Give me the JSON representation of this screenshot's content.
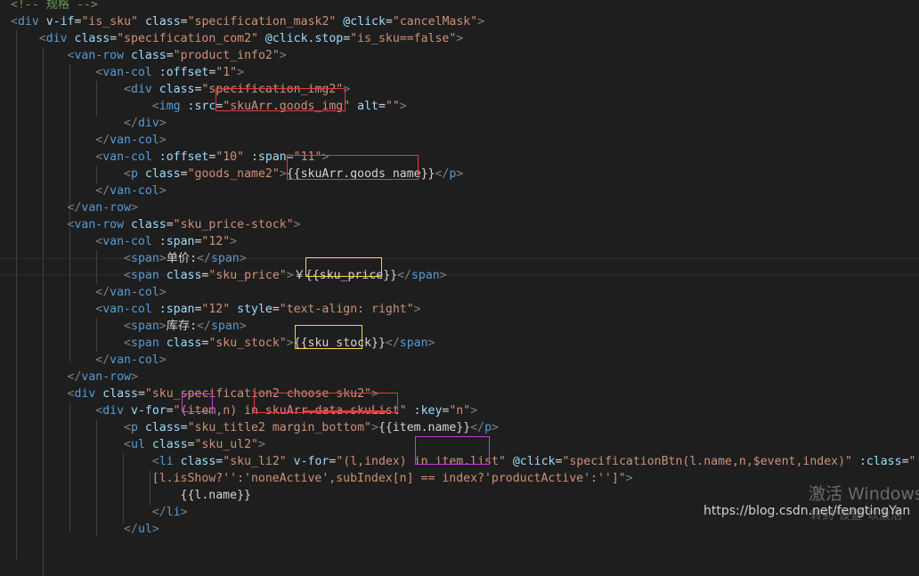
{
  "editor": {
    "lines": [
      [
        [
          "c",
          "<!-- 规格 -->"
        ]
      ],
      [
        [
          "p",
          "<"
        ],
        [
          "t",
          "div"
        ],
        [
          "x",
          " "
        ],
        [
          "a",
          "v-if"
        ],
        [
          "x",
          "="
        ],
        [
          "s",
          "\"is_sku\""
        ],
        [
          "x",
          " "
        ],
        [
          "a",
          "class"
        ],
        [
          "x",
          "="
        ],
        [
          "s",
          "\"specification_mask2\""
        ],
        [
          "x",
          " "
        ],
        [
          "a",
          "@click"
        ],
        [
          "x",
          "="
        ],
        [
          "s",
          "\"cancelMask\""
        ],
        [
          "p",
          ">"
        ]
      ],
      [
        [
          "x",
          "    "
        ],
        [
          "p",
          "<"
        ],
        [
          "t",
          "div"
        ],
        [
          "x",
          " "
        ],
        [
          "a",
          "class"
        ],
        [
          "x",
          "="
        ],
        [
          "s",
          "\"specification_com2\""
        ],
        [
          "x",
          " "
        ],
        [
          "a",
          "@click.stop"
        ],
        [
          "x",
          "="
        ],
        [
          "s",
          "\"is_sku==false\""
        ],
        [
          "p",
          ">"
        ]
      ],
      [
        [
          "x",
          "        "
        ],
        [
          "p",
          "<"
        ],
        [
          "t",
          "van-row"
        ],
        [
          "x",
          " "
        ],
        [
          "a",
          "class"
        ],
        [
          "x",
          "="
        ],
        [
          "s",
          "\"product_info2\""
        ],
        [
          "p",
          ">"
        ]
      ],
      [
        [
          "x",
          "            "
        ],
        [
          "p",
          "<"
        ],
        [
          "t",
          "van-col"
        ],
        [
          "x",
          " "
        ],
        [
          "a",
          ":offset"
        ],
        [
          "x",
          "="
        ],
        [
          "s",
          "\"1\""
        ],
        [
          "p",
          ">"
        ]
      ],
      [
        [
          "x",
          "                "
        ],
        [
          "p",
          "<"
        ],
        [
          "t",
          "div"
        ],
        [
          "x",
          " "
        ],
        [
          "a",
          "class"
        ],
        [
          "x",
          "="
        ],
        [
          "s",
          "\"specification_img2\""
        ],
        [
          "p",
          ">"
        ]
      ],
      [
        [
          "x",
          "                    "
        ],
        [
          "p",
          "<"
        ],
        [
          "t",
          "img"
        ],
        [
          "x",
          " "
        ],
        [
          "a",
          ":src"
        ],
        [
          "x",
          "="
        ],
        [
          "s",
          "\"skuArr.goods_img\""
        ],
        [
          "x",
          " "
        ],
        [
          "a",
          "alt"
        ],
        [
          "x",
          "="
        ],
        [
          "s",
          "\"\""
        ],
        [
          "p",
          ">"
        ]
      ],
      [
        [
          "x",
          "                "
        ],
        [
          "p",
          "</"
        ],
        [
          "t",
          "div"
        ],
        [
          "p",
          ">"
        ]
      ],
      [
        [
          "x",
          "            "
        ],
        [
          "p",
          "</"
        ],
        [
          "t",
          "van-col"
        ],
        [
          "p",
          ">"
        ]
      ],
      [
        [
          "x",
          "            "
        ],
        [
          "p",
          "<"
        ],
        [
          "t",
          "van-col"
        ],
        [
          "x",
          " "
        ],
        [
          "a",
          ":offset"
        ],
        [
          "x",
          "="
        ],
        [
          "s",
          "\"10\""
        ],
        [
          "x",
          " "
        ],
        [
          "a",
          ":span"
        ],
        [
          "x",
          "="
        ],
        [
          "s",
          "\"11\""
        ],
        [
          "p",
          ">"
        ]
      ],
      [
        [
          "x",
          "                "
        ],
        [
          "p",
          "<"
        ],
        [
          "t",
          "p"
        ],
        [
          "x",
          " "
        ],
        [
          "a",
          "class"
        ],
        [
          "x",
          "="
        ],
        [
          "s",
          "\"goods_name2\""
        ],
        [
          "p",
          ">"
        ],
        [
          "x",
          "{{skuArr.goods_name}}"
        ],
        [
          "p",
          "</"
        ],
        [
          "t",
          "p"
        ],
        [
          "p",
          ">"
        ]
      ],
      [
        [
          "x",
          "            "
        ],
        [
          "p",
          "</"
        ],
        [
          "t",
          "van-col"
        ],
        [
          "p",
          ">"
        ]
      ],
      [
        [
          "x",
          "        "
        ],
        [
          "p",
          "</"
        ],
        [
          "t",
          "van-row"
        ],
        [
          "p",
          ">"
        ]
      ],
      [
        [
          "x",
          "        "
        ],
        [
          "p",
          "<"
        ],
        [
          "t",
          "van-row"
        ],
        [
          "x",
          " "
        ],
        [
          "a",
          "class"
        ],
        [
          "x",
          "="
        ],
        [
          "s",
          "\"sku_price-stock\""
        ],
        [
          "p",
          ">"
        ]
      ],
      [
        [
          "x",
          "            "
        ],
        [
          "p",
          "<"
        ],
        [
          "t",
          "van-col"
        ],
        [
          "x",
          " "
        ],
        [
          "a",
          ":span"
        ],
        [
          "x",
          "="
        ],
        [
          "s",
          "\"12\""
        ],
        [
          "p",
          ">"
        ]
      ],
      [
        [
          "x",
          "                "
        ],
        [
          "p",
          "<"
        ],
        [
          "t",
          "span"
        ],
        [
          "p",
          ">"
        ],
        [
          "x",
          "单价:"
        ],
        [
          "p",
          "</"
        ],
        [
          "t",
          "span"
        ],
        [
          "p",
          ">"
        ]
      ],
      [
        [
          "x",
          "                "
        ],
        [
          "p",
          "<"
        ],
        [
          "t",
          "span"
        ],
        [
          "x",
          " "
        ],
        [
          "a",
          "class"
        ],
        [
          "x",
          "="
        ],
        [
          "s",
          "\"sku_price\""
        ],
        [
          "p",
          ">"
        ],
        [
          "x",
          "￥{{sku_price}}"
        ],
        [
          "p",
          "</"
        ],
        [
          "t",
          "span"
        ],
        [
          "p",
          ">"
        ]
      ],
      [
        [
          "x",
          "            "
        ],
        [
          "p",
          "</"
        ],
        [
          "t",
          "van-col"
        ],
        [
          "p",
          ">"
        ]
      ],
      [
        [
          "x",
          "            "
        ],
        [
          "p",
          "<"
        ],
        [
          "t",
          "van-col"
        ],
        [
          "x",
          " "
        ],
        [
          "a",
          ":span"
        ],
        [
          "x",
          "="
        ],
        [
          "s",
          "\"12\""
        ],
        [
          "x",
          " "
        ],
        [
          "a",
          "style"
        ],
        [
          "x",
          "="
        ],
        [
          "s",
          "\"text-align: right\""
        ],
        [
          "p",
          ">"
        ]
      ],
      [
        [
          "x",
          "                "
        ],
        [
          "p",
          "<"
        ],
        [
          "t",
          "span"
        ],
        [
          "p",
          ">"
        ],
        [
          "x",
          "库存:"
        ],
        [
          "p",
          "</"
        ],
        [
          "t",
          "span"
        ],
        [
          "p",
          ">"
        ]
      ],
      [
        [
          "x",
          "                "
        ],
        [
          "p",
          "<"
        ],
        [
          "t",
          "span"
        ],
        [
          "x",
          " "
        ],
        [
          "a",
          "class"
        ],
        [
          "x",
          "="
        ],
        [
          "s",
          "\"sku_stock\""
        ],
        [
          "p",
          ">"
        ],
        [
          "x",
          "{{sku_stock}}"
        ],
        [
          "p",
          "</"
        ],
        [
          "t",
          "span"
        ],
        [
          "p",
          ">"
        ]
      ],
      [
        [
          "x",
          "            "
        ],
        [
          "p",
          "</"
        ],
        [
          "t",
          "van-col"
        ],
        [
          "p",
          ">"
        ]
      ],
      [
        [
          "x",
          "        "
        ],
        [
          "p",
          "</"
        ],
        [
          "t",
          "van-row"
        ],
        [
          "p",
          ">"
        ]
      ],
      [
        [
          "x",
          "        "
        ],
        [
          "p",
          "<"
        ],
        [
          "t",
          "div"
        ],
        [
          "x",
          " "
        ],
        [
          "a",
          "class"
        ],
        [
          "x",
          "="
        ],
        [
          "s",
          "\"sku_specification2 choose sku2\""
        ],
        [
          "p",
          ">"
        ]
      ],
      [
        [
          "x",
          "            "
        ],
        [
          "p",
          "<"
        ],
        [
          "t",
          "div"
        ],
        [
          "x",
          " "
        ],
        [
          "a",
          "v-for"
        ],
        [
          "x",
          "="
        ],
        [
          "s",
          "\"(item,n) in skuArr.data.skuList\""
        ],
        [
          "x",
          " "
        ],
        [
          "a",
          ":key"
        ],
        [
          "x",
          "="
        ],
        [
          "s",
          "\"n\""
        ],
        [
          "p",
          ">"
        ]
      ],
      [
        [
          "x",
          "                "
        ],
        [
          "p",
          "<"
        ],
        [
          "t",
          "p"
        ],
        [
          "x",
          " "
        ],
        [
          "a",
          "class"
        ],
        [
          "x",
          "="
        ],
        [
          "s",
          "\"sku_title2 margin_bottom\""
        ],
        [
          "p",
          ">"
        ],
        [
          "x",
          "{{item.name}}"
        ],
        [
          "p",
          "</"
        ],
        [
          "t",
          "p"
        ],
        [
          "p",
          ">"
        ]
      ],
      [
        [
          "x",
          "                "
        ],
        [
          "p",
          "<"
        ],
        [
          "t",
          "ul"
        ],
        [
          "x",
          " "
        ],
        [
          "a",
          "class"
        ],
        [
          "x",
          "="
        ],
        [
          "s",
          "\"sku_ul2\""
        ],
        [
          "p",
          ">"
        ]
      ],
      [
        [
          "x",
          "                    "
        ],
        [
          "p",
          "<"
        ],
        [
          "t",
          "li"
        ],
        [
          "x",
          " "
        ],
        [
          "a",
          "class"
        ],
        [
          "x",
          "="
        ],
        [
          "s",
          "\"sku_li2\""
        ],
        [
          "x",
          " "
        ],
        [
          "a",
          "v-for"
        ],
        [
          "x",
          "="
        ],
        [
          "s",
          "\"(l,index) in item.list\""
        ],
        [
          "x",
          " "
        ],
        [
          "a",
          "@click"
        ],
        [
          "x",
          "="
        ],
        [
          "s",
          "\"specificationBtn(l.name,n,$event,index)\""
        ],
        [
          "x",
          " "
        ],
        [
          "a",
          ":class"
        ],
        [
          "x",
          "="
        ],
        [
          "s",
          "\""
        ]
      ],
      [
        [
          "x",
          "                    "
        ],
        [
          "s",
          "[l.isShow?'':'noneActive',subIndex[n] == index?'productActive':'']\""
        ],
        [
          "p",
          ">"
        ]
      ],
      [
        [
          "x",
          "                        {{l.name}}"
        ]
      ],
      [
        [
          "x",
          "                    "
        ],
        [
          "p",
          "</"
        ],
        [
          "t",
          "li"
        ],
        [
          "p",
          ">"
        ]
      ],
      [
        [
          "x",
          "                "
        ],
        [
          "p",
          "</"
        ],
        [
          "t",
          "ul"
        ],
        [
          "p",
          ">"
        ]
      ]
    ]
  },
  "watermark": {
    "activate": "激活 Windows",
    "url": "https://blog.csdn.net/fengtingYan",
    "activate_sub": "转到\"设置\"以激活"
  },
  "colors": {
    "background": "#1e1e1e",
    "tag": "#569cd6",
    "attribute": "#9cdcfe",
    "string": "#ce9178",
    "punctuation": "#808080",
    "annotation_red": "#e03c3c",
    "annotation_yellow": "#e6d84a",
    "annotation_magenta": "#c03fd8"
  }
}
